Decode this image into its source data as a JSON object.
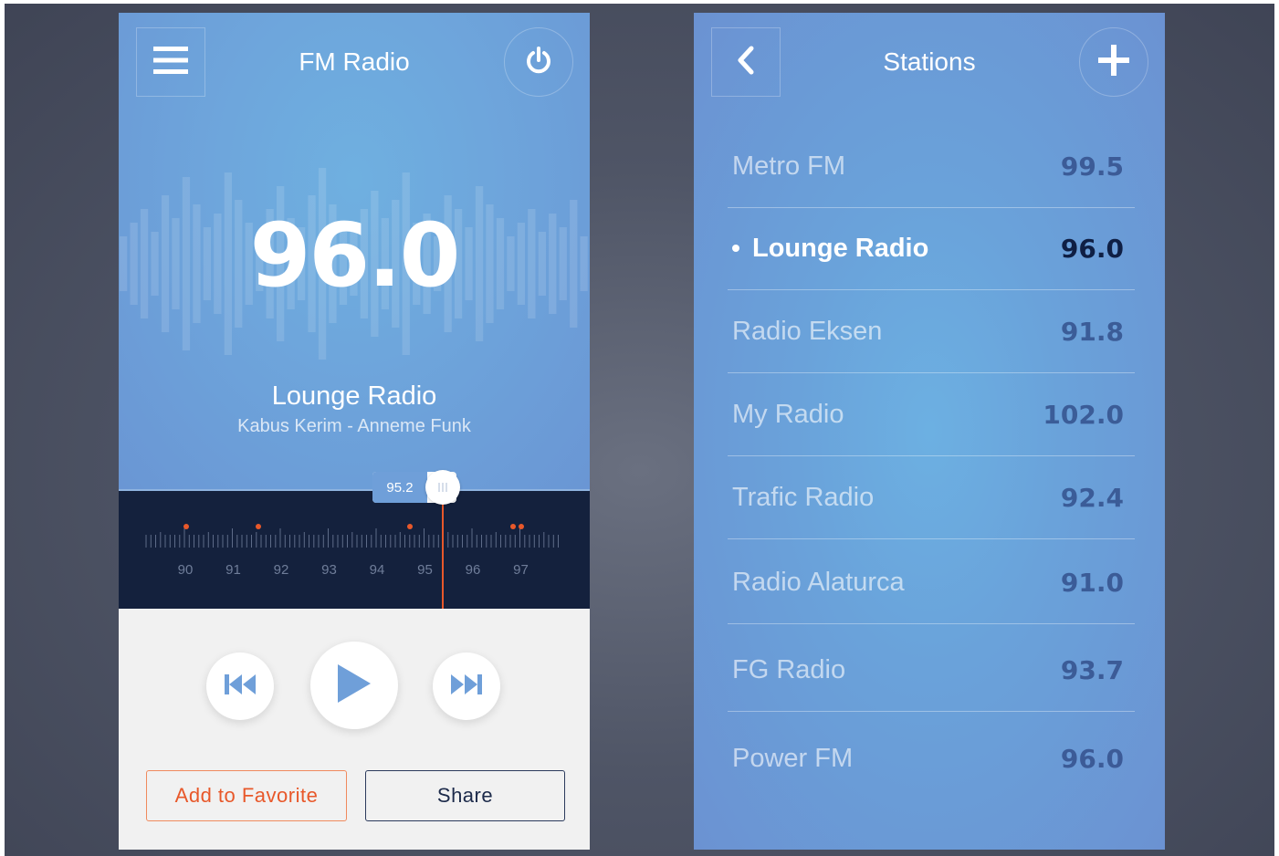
{
  "player": {
    "title": "FM Radio",
    "menu_icon": "hamburger-menu-icon",
    "power_icon": "power-icon",
    "frequency": "96.0",
    "station": "Lounge Radio",
    "track": "Kabus Kerim - Anneme Funk",
    "tuner": {
      "current_value": "95.2",
      "ticks": [
        "90",
        "91",
        "92",
        "93",
        "94",
        "95",
        "96",
        "97"
      ]
    },
    "controls": {
      "prev_icon": "skip-previous-icon",
      "play_icon": "play-icon",
      "next_icon": "skip-next-icon"
    },
    "buttons": {
      "favorite": "Add to Favorite",
      "share": "Share"
    },
    "colors": {
      "accent": "#e8582a",
      "tuner_bg": "#14213d",
      "control_blue": "#6f9fd9"
    }
  },
  "stations": {
    "title": "Stations",
    "back_icon": "chevron-left-icon",
    "add_icon": "plus-icon",
    "items": [
      {
        "name": "Metro FM",
        "freq": "99.5"
      },
      {
        "name": "Lounge Radio",
        "freq": "96.0"
      },
      {
        "name": "Radio Eksen",
        "freq": "91.8"
      },
      {
        "name": "My Radio",
        "freq": "102.0"
      },
      {
        "name": "Trafic Radio",
        "freq": "92.4"
      },
      {
        "name": "Radio Alaturca",
        "freq": "91.0"
      },
      {
        "name": "FG Radio",
        "freq": "93.7"
      },
      {
        "name": "Power FM",
        "freq": "96.0"
      }
    ],
    "active_index": 1
  }
}
